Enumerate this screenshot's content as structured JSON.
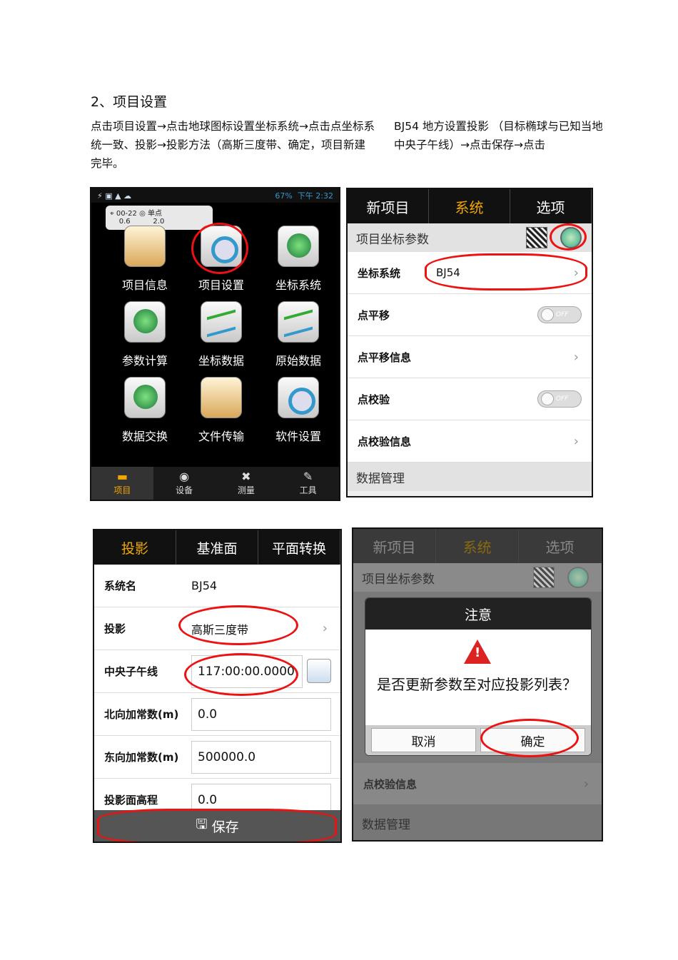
{
  "heading": "2、项目设置",
  "instructions": {
    "left": "点击项目设置→点击地球图标设置坐标系统→点击点坐标系统一致、投影→投影方法（高斯三度带、确定，项目新建完毕。",
    "right": "BJ54 地方设置投影 （目标椭球与已知当地 中央子午线）→点击保存→点击"
  },
  "shot1": {
    "status_time": "下午 2:32",
    "status_battery": "67%",
    "tip": {
      "a": "00-22",
      "b": "0.6",
      "c": "单点",
      "d": "2.0"
    },
    "grid": [
      "项目信息",
      "项目设置",
      "坐标系统",
      "参数计算",
      "坐标数据",
      "原始数据",
      "数据交换",
      "文件传输",
      "软件设置"
    ],
    "tabs": [
      "项目",
      "设备",
      "测量",
      "工具"
    ]
  },
  "shot2": {
    "tabs": [
      "新项目",
      "系统",
      "选项"
    ],
    "section": "项目坐标参数",
    "rows": [
      {
        "label": "坐标系统",
        "value": "BJ54"
      },
      {
        "label": "点平移",
        "toggle": "OFF"
      },
      {
        "label": "点平移信息"
      },
      {
        "label": "点校验",
        "toggle": "OFF"
      },
      {
        "label": "点校验信息"
      }
    ],
    "footer": "数据管理"
  },
  "shot3": {
    "tabs": [
      "投影",
      "基准面",
      "平面转换"
    ],
    "fields": [
      {
        "label": "系统名",
        "value": "BJ54"
      },
      {
        "label": "投影",
        "value": "高斯三度带"
      },
      {
        "label": "中央子午线",
        "value": "117:00:00.0000"
      },
      {
        "label": "北向加常数(m)",
        "value": "0.0"
      },
      {
        "label": "东向加常数(m)",
        "value": "500000.0"
      },
      {
        "label": "投影面高程",
        "value": "0.0"
      }
    ],
    "save": "保存"
  },
  "shot4": {
    "tabs": [
      "新项目",
      "系统",
      "选项"
    ],
    "section": "项目坐标参数",
    "dialog": {
      "title": "注意",
      "message": "是否更新参数至对应投影列表？",
      "cancel": "取消",
      "ok": "确定"
    },
    "row": "点校验信息",
    "footer": "数据管理"
  }
}
